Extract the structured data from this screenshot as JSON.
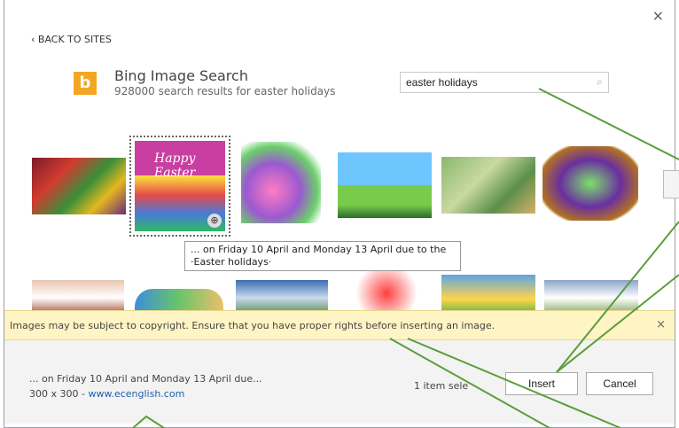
{
  "dialog": {
    "close_glyph": "×"
  },
  "nav": {
    "back_label": "‹ BACK TO SITES"
  },
  "provider": {
    "logo_glyph": "b",
    "title": "Bing Image Search",
    "subtitle": "928000 search results for easter holidays"
  },
  "search": {
    "value": "easter holidays",
    "icon": "search-icon"
  },
  "thumbnails": {
    "row1": [
      "easter-eggs",
      "happy-easter-eggs",
      "easter-eggs-clipart",
      "easter-bunny",
      "easter-bunnies-basket",
      "easter-egg-basket"
    ],
    "row2": [
      "easter-sheep",
      "easter-eggs-row",
      "easter-tree",
      "happy-sign",
      "easter-chicks",
      "easter-flowers"
    ],
    "selected_caption": "Happy Easter"
  },
  "tooltip": {
    "line1": "... on Friday 10 April and Monday 13 April due to the",
    "line2": "·Easter holidays·"
  },
  "copyright_banner": {
    "message": "Images may be subject to copyright. Ensure that you have proper rights before inserting an image.",
    "close_glyph": "×"
  },
  "footer": {
    "description": "... on Friday 10 April and Monday 13 April due...",
    "dimensions": "300 x 300 - ",
    "source_link": "www.ecenglish.com",
    "selection_count": "1 item sele",
    "insert_label": "Insert",
    "cancel_label": "Cancel"
  },
  "colors": {
    "bing_orange": "#f4a623",
    "banner_bg": "#fff4c4",
    "callout_green": "#5a9e3a",
    "link_blue": "#1f5faa"
  }
}
